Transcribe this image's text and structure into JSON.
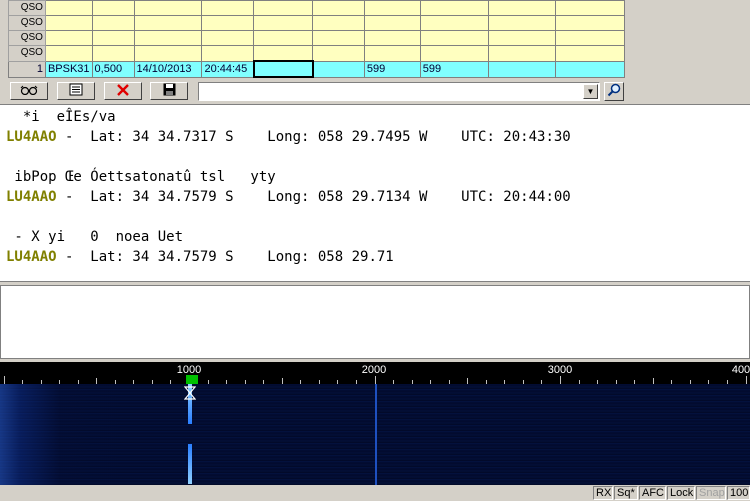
{
  "log": {
    "qso_rows": [
      {
        "label": "QSO"
      },
      {
        "label": "QSO"
      },
      {
        "label": "QSO"
      },
      {
        "label": "QSO"
      }
    ],
    "current_row": {
      "index": "1",
      "mode": "BPSK31",
      "freq": "0,500",
      "date": "14/10/2013",
      "time": "20:44:45",
      "rst_sent": "599",
      "rst_rcvd": "599"
    }
  },
  "toolbar": {
    "buttons": [
      {
        "name": "glasses-icon"
      },
      {
        "name": "document-icon"
      },
      {
        "name": "delete-x-icon",
        "color": "#e00000"
      },
      {
        "name": "save-disk-icon"
      }
    ],
    "combo_value": ""
  },
  "rx_text": {
    "lines": [
      {
        "pre": "  *i  eÎEs/va",
        "call": "",
        "post": ""
      },
      {
        "pre": "",
        "call": "LU4AAO",
        "post": " -  Lat: 34 34.7317 S    Long: 058 29.7495 W    UTC: 20:43:30"
      },
      {
        "pre": "",
        "call": "",
        "post": ""
      },
      {
        "pre": " ibPop Œe Óettsatonatû tsl   yty",
        "call": "",
        "post": ""
      },
      {
        "pre": "",
        "call": "LU4AAO",
        "post": " -  Lat: 34 34.7579 S    Long: 058 29.7134 W    UTC: 20:44:00"
      },
      {
        "pre": "",
        "call": "",
        "post": ""
      },
      {
        "pre": " - X yi   0  noea Uet",
        "call": "",
        "post": ""
      },
      {
        "pre": "",
        "call": "LU4AAO",
        "post": " -  Lat: 34 34.7579 S    Long: 058 29.71"
      }
    ],
    "call_color": "#808000"
  },
  "waterfall": {
    "scale_labels": [
      "1000",
      "2000",
      "3000",
      "400"
    ],
    "cursor_color": "#00c000"
  },
  "status_bar": {
    "items": [
      {
        "label": "RX",
        "enabled": true
      },
      {
        "label": "Sq*",
        "enabled": true
      },
      {
        "label": "AFC",
        "enabled": true
      },
      {
        "label": "Lock",
        "enabled": true
      },
      {
        "label": "Snap",
        "enabled": false
      },
      {
        "label": "100",
        "enabled": true
      }
    ]
  }
}
